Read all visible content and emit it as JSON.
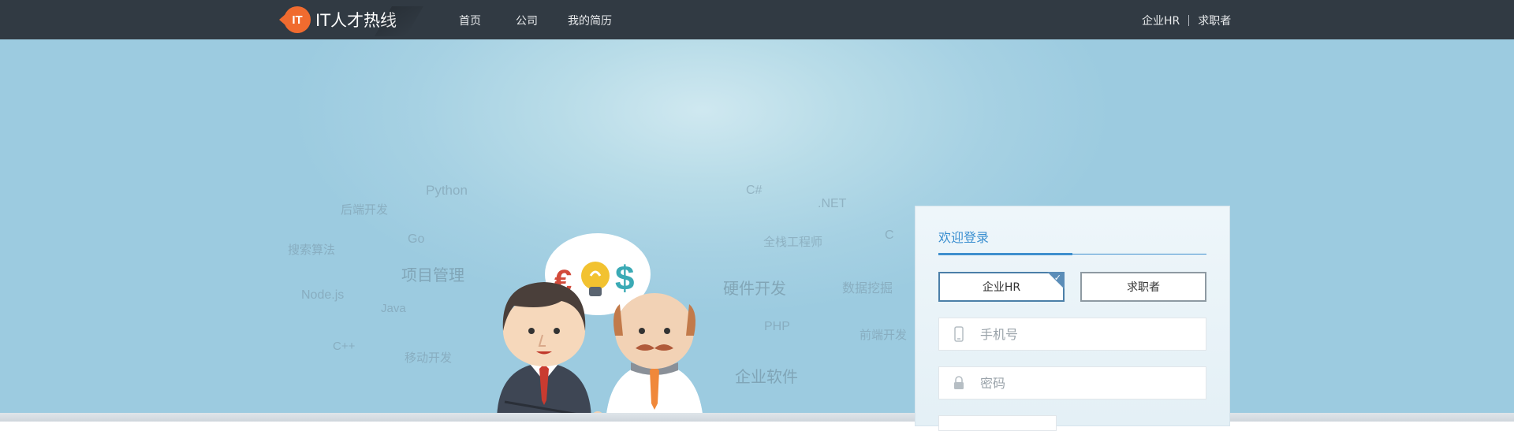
{
  "logo": {
    "badge": "IT",
    "text": "IT人才热线"
  },
  "nav": {
    "items": [
      {
        "label": "首页"
      },
      {
        "label": "公司"
      },
      {
        "label": "我的简历"
      }
    ],
    "right": {
      "hr_label": "企业HR",
      "seeker_label": "求职者"
    }
  },
  "hero": {
    "tags": [
      "Python",
      "后端开发",
      "Go",
      "搜索算法",
      "项目管理",
      "Node.js",
      "Java",
      "C++",
      "移动开发",
      "C#",
      ".NET",
      "全栈工程师",
      "C",
      "硬件开发",
      "数据挖掘",
      "PHP",
      "前端开发",
      "企业软件"
    ]
  },
  "login": {
    "title": "欢迎登录",
    "role_hr": "企业HR",
    "role_seeker": "求职者",
    "phone_placeholder": "手机号",
    "password_placeholder": "密码"
  },
  "colors": {
    "topbar": "#313a43",
    "brand_orange": "#f06b2f",
    "accent_blue": "#3a8fd0"
  }
}
